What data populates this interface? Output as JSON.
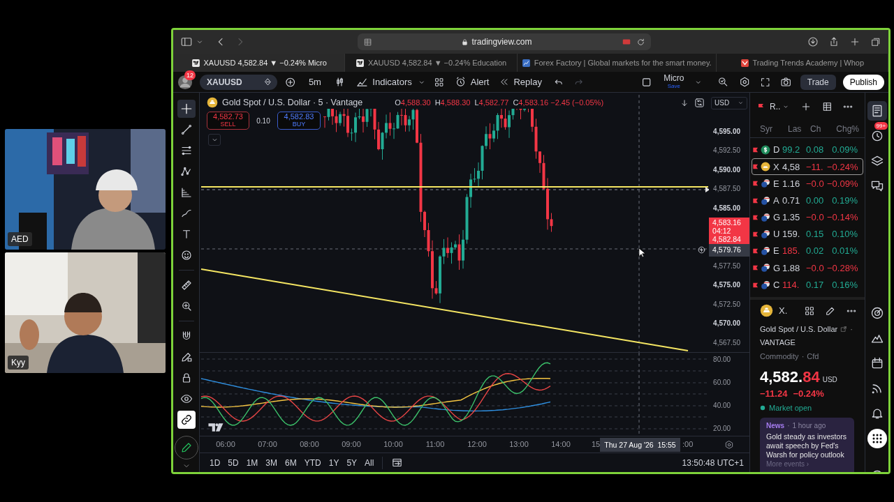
{
  "webcams": [
    {
      "label": "AED",
      "kind": "picture"
    },
    {
      "label": "Kyy",
      "kind": "picture"
    }
  ],
  "browser": {
    "url": "tradingview.com",
    "tabs": [
      {
        "label": "XAUUSD 4,582.84 ▼ −0.24% Micro",
        "kind": "chart",
        "selected": true
      },
      {
        "label": "XAUUSD 4,582.84 ▼ −0.24% Education",
        "kind": "chart",
        "selected": false
      },
      {
        "label": "Forex Factory | Global markets for the smart money.",
        "kind": "news",
        "selected": false
      },
      {
        "label": "Trading Trends Academy | Whop",
        "kind": "academy",
        "selected": false
      }
    ]
  },
  "toolbar": {
    "notifications": "12",
    "symbol": "XAUUSD",
    "interval": "5m",
    "indicators": "Indicators",
    "alert": "Alert",
    "replay": "Replay",
    "redo_disabled": true,
    "layout": {
      "name": "Micro",
      "status": "Save"
    },
    "trade": "Trade",
    "publish": "Publish"
  },
  "tool_groups": [
    {
      "tools": [
        {
          "kind": "crosshair",
          "selected": true,
          "on": false
        },
        {
          "kind": "line",
          "selected": false,
          "on": false
        },
        {
          "kind": "fib",
          "selected": false,
          "on": false
        },
        {
          "kind": "pattern",
          "selected": false,
          "on": false
        },
        {
          "kind": "forecast",
          "selected": false,
          "on": false
        },
        {
          "kind": "brush",
          "selected": false,
          "on": false
        },
        {
          "kind": "text",
          "selected": false,
          "on": false
        },
        {
          "kind": "emoji",
          "selected": false,
          "on": false
        }
      ]
    },
    {
      "tools": [
        {
          "kind": "ruler",
          "selected": false,
          "on": false
        },
        {
          "kind": "zoom",
          "selected": false,
          "on": false
        }
      ]
    },
    {
      "tools": [
        {
          "kind": "magnet",
          "selected": false,
          "on": false
        },
        {
          "kind": "draw-lock",
          "selected": false,
          "on": false
        },
        {
          "kind": "lock",
          "selected": false,
          "on": false
        },
        {
          "kind": "eye",
          "selected": false,
          "on": false
        },
        {
          "kind": "link",
          "selected": false,
          "on": true
        }
      ]
    }
  ],
  "chart": {
    "title": "Gold Spot / U.S. Dollar · 5 · Vantage",
    "ohlc": [
      {
        "label": "O",
        "value": "4,588.30"
      },
      {
        "label": "H",
        "value": "4,588.30"
      },
      {
        "label": "L",
        "value": "4,582.77"
      },
      {
        "label": "C",
        "value": "4,583.16 −2.45 (−0.05%)"
      }
    ],
    "sell": {
      "price": "4,582.73",
      "label": "SELL"
    },
    "spread": "0.10",
    "buy": {
      "price": "4,582.83",
      "label": "BUY"
    },
    "currency": "USD",
    "price_axis": [
      {
        "kind": "tick",
        "value": "4,595.00",
        "major": true
      },
      {
        "kind": "tick",
        "value": "4,592.50",
        "major": false
      },
      {
        "kind": "tick",
        "value": "4,590.00",
        "major": true
      },
      {
        "kind": "tick",
        "value": "4,587.50",
        "major": false
      },
      {
        "kind": "tick",
        "value": "4,585.00",
        "major": true
      },
      {
        "kind": "last_price",
        "value": "4,583.16",
        "countdown": "04:12",
        "bid": "4,582.84"
      },
      {
        "kind": "crosshair",
        "value": "4,579.76"
      },
      {
        "kind": "tick",
        "value": "4,577.50",
        "major": false
      },
      {
        "kind": "tick",
        "value": "4,575.00",
        "major": true
      },
      {
        "kind": "tick",
        "value": "4,572.50",
        "major": false
      },
      {
        "kind": "tick",
        "value": "4,570.00",
        "major": true
      },
      {
        "kind": "tick",
        "value": "4,567.50",
        "major": false
      }
    ],
    "indicator_ticks": [
      "80.00",
      "60.00",
      "40.00",
      "20.00"
    ],
    "time_ticks": [
      "06:00",
      "07:00",
      "08:00",
      "09:00",
      "10:00",
      "11:00",
      "12:00",
      "13:00",
      "14:00"
    ],
    "time_cut_before": "15",
    "crosshair_time": "Thu 27 Aug '26  15:55",
    "time_cut_after": ":00",
    "ranges": [
      "1D",
      "5D",
      "1M",
      "3M",
      "6M",
      "YTD",
      "1Y",
      "5Y",
      "All"
    ],
    "clock": "13:50:48 UTC+1"
  },
  "watchlist": {
    "title": "R..",
    "columns": [
      "Syr",
      "Las",
      "Ch",
      "Chg%"
    ],
    "rows": [
      {
        "kind": "index",
        "symbol": "D",
        "last": {
          "value": "99.2",
          "color": "#22ab94"
        },
        "change": "0.08",
        "change_pct": "0.09%",
        "color": "#22ab94",
        "selected": false
      },
      {
        "kind": "commodity",
        "symbol": "X",
        "last": {
          "value": "4,58",
          "color": "#d1d4dc"
        },
        "change": "−11.",
        "change_pct": "−0.24%",
        "color": "#f23645",
        "selected": true
      },
      {
        "kind": "forex",
        "symbol": "E",
        "last": {
          "value": "1.16",
          "color": "#d1d4dc"
        },
        "change": "−0.0",
        "change_pct": "−0.09%",
        "color": "#f23645",
        "selected": false
      },
      {
        "kind": "forex",
        "symbol": "A",
        "last": {
          "value": "0.71",
          "color": "#d1d4dc"
        },
        "change": "0.00",
        "change_pct": "0.19%",
        "color": "#22ab94",
        "selected": false
      },
      {
        "kind": "forex",
        "symbol": "G",
        "last": {
          "value": "1.35",
          "color": "#d1d4dc"
        },
        "change": "−0.0",
        "change_pct": "−0.14%",
        "color": "#f23645",
        "selected": false
      },
      {
        "kind": "forex",
        "symbol": "U",
        "last": {
          "value": "159.",
          "color": "#d1d4dc"
        },
        "change": "0.15",
        "change_pct": "0.10%",
        "color": "#22ab94",
        "selected": false
      },
      {
        "kind": "forex",
        "symbol": "E",
        "last": {
          "value": "185.",
          "color": "#f23645"
        },
        "change": "0.02",
        "change_pct": "0.01%",
        "color": "#22ab94",
        "selected": false
      },
      {
        "kind": "forex",
        "symbol": "G",
        "last": {
          "value": "1.88",
          "color": "#d1d4dc"
        },
        "change": "−0.0",
        "change_pct": "−0.28%",
        "color": "#f23645",
        "selected": false
      },
      {
        "kind": "forex",
        "symbol": "C",
        "last": {
          "value": "114.",
          "color": "#f23645"
        },
        "change": "0.17",
        "change_pct": "0.16%",
        "color": "#22ab94",
        "selected": false
      }
    ]
  },
  "details": {
    "symbol": "X.",
    "name": "Gold Spot / U.S. Dollar",
    "separator": "·",
    "exchange": "VANTAGE",
    "type": "Commodity",
    "subtype": "Cfd",
    "price": "4,582.",
    "price_tail": "84",
    "currency": "USD",
    "change": "−11.24",
    "change_pct": "−0.24%",
    "status": "Market open",
    "news": {
      "source": "News",
      "time": "1 hour ago",
      "headline": "Gold steady as investors await speech by Fed's Warsh for policy outlook",
      "more": "More events ›"
    }
  },
  "side_icons": [
    {
      "kind": "watchlist",
      "selected": true
    },
    {
      "kind": "clock",
      "selected": false,
      "badge": "99+"
    },
    {
      "kind": "layers",
      "selected": false
    },
    {
      "kind": "chat",
      "selected": false
    },
    {
      "kind": "target",
      "selected": false
    },
    {
      "kind": "ideas",
      "selected": false
    },
    {
      "kind": "calendar",
      "selected": false
    },
    {
      "kind": "stream",
      "selected": false
    },
    {
      "kind": "alerts",
      "selected": false
    },
    {
      "kind": "apps",
      "selected": false
    },
    {
      "kind": "help",
      "selected": false
    }
  ]
}
